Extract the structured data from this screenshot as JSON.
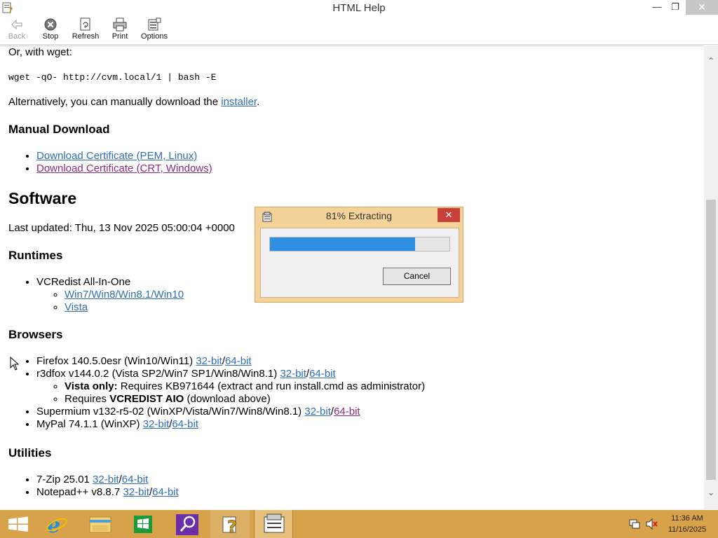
{
  "window": {
    "title": "HTML Help"
  },
  "toolbar": {
    "back": "Back",
    "stop": "Stop",
    "refresh": "Refresh",
    "print": "Print",
    "options": "Options"
  },
  "content": {
    "wget_intro": "Or, with wget:",
    "wget_cmd": "wget -qO- http://cvm.local/1 | bash -E",
    "alt_text": "Alternatively, you can manually download the ",
    "installer_link": "installer",
    "alt_period": ".",
    "manual_download_heading": "Manual Download",
    "cert_pem": "Download Certificate (PEM, Linux)",
    "cert_crt": "Download Certificate (CRT, Windows)",
    "software_heading": "Software",
    "last_updated": "Last updated: Thu, 13 Nov 2025 05:00:04 +0000",
    "runtimes_heading": "Runtimes",
    "vcredist": "VCRedist All-In-One",
    "vcredist_win": "Win7/Win8/Win8.1/Win10",
    "vcredist_vista": "Vista",
    "browsers_heading": "Browsers",
    "firefox": "Firefox 140.5.0esr (Win10/Win11) ",
    "r3dfox": "r3dfox v144.0.2 (Vista SP2/Win7 SP1/Win8/Win8.1) ",
    "vista_only_bold": "Vista only:",
    "vista_only_rest": " Requires KB971644 (extract and run install.cmd as administrator)",
    "requires_pre": "Requires ",
    "requires_bold": "VCREDIST AIO",
    "requires_post": " (download above)",
    "supermium": "Supermium v132-r5-02 (WinXP/Vista/Win7/Win8/Win8.1) ",
    "mypal": "MyPal 74.1.1 (WinXP) ",
    "utilities_heading": "Utilities",
    "sevenzip": "7-Zip 25.01 ",
    "notepadpp": "Notepad++ v8.8.7 ",
    "link_32": "32-bit",
    "link_64": "64-bit",
    "slash": "/"
  },
  "dialog": {
    "title": "81% Extracting",
    "progress": 0.81,
    "cancel": "Cancel"
  },
  "taskbar": {
    "items": [
      "start-button",
      "internet-explorer",
      "file-explorer",
      "store",
      "search",
      "html-help",
      "extractor"
    ],
    "time": "11:36 AM",
    "date": "11/16/2025"
  },
  "colors": {
    "link": "#2e6db4",
    "visited_link": "#8b2c7a",
    "progress_fill": "#2f8fe0",
    "taskbar": "#d8a24a",
    "dialog_frame": "#f3d39a"
  }
}
